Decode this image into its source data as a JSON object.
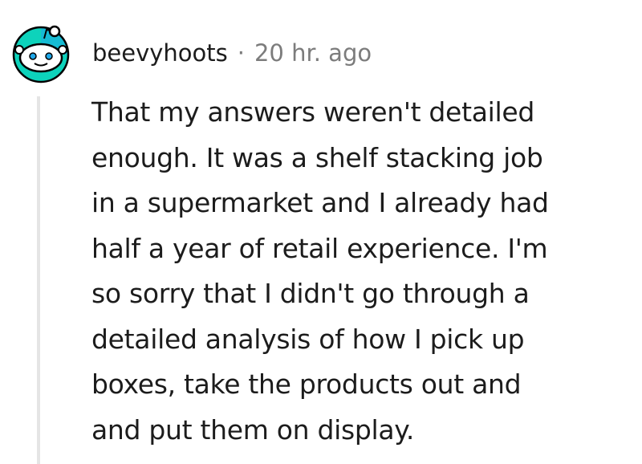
{
  "comment": {
    "author": "beevyhoots",
    "separator": "·",
    "timestamp": "20 hr. ago",
    "avatar_icon": "reddit-snoo-avatar-icon",
    "accent_color": "#0dd3bb",
    "body_lines": [
      "That my answers weren't detailed",
      "enough. It was a shelf stacking job",
      "in a supermarket and I already had",
      "half a year of retail experience. I'm",
      "so sorry that I didn't go through a",
      "detailed analysis of how I pick up",
      "boxes, take the products out and",
      "and put them on display."
    ]
  }
}
